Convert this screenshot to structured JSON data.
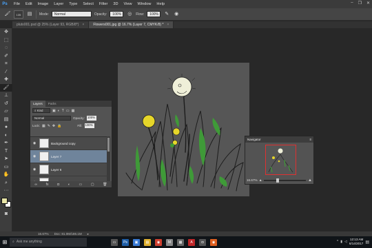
{
  "app": {
    "logo": "Ps"
  },
  "menu": [
    "File",
    "Edit",
    "Image",
    "Layer",
    "Type",
    "Select",
    "Filter",
    "3D",
    "View",
    "Window",
    "Help"
  ],
  "window_controls": [
    "–",
    "❐",
    "✕"
  ],
  "options": {
    "brush_size": "135",
    "mode_label": "Mode:",
    "mode_value": "Normal",
    "opacity_label": "Opacity:",
    "opacity_value": "100%",
    "flow_label": "Flow:",
    "flow_value": "100%"
  },
  "tabs": [
    {
      "label": "pluto001.psd @ 25% (Layer 93, RGB/8*)",
      "close": "×",
      "active": false
    },
    {
      "label": "Flowers001.jpg @ 16.7% (Layer 7, CMYK/8) *",
      "close": "×",
      "active": true
    }
  ],
  "tools": [
    "move-tool",
    "marquee-tool",
    "lasso-tool",
    "quick-select-tool",
    "crop-tool",
    "eyedropper-tool",
    "healing-tool",
    "brush-tool",
    "stamp-tool",
    "history-brush-tool",
    "eraser-tool",
    "gradient-tool",
    "blur-tool",
    "dodge-tool",
    "pen-tool",
    "type-tool",
    "path-select-tool",
    "shape-tool",
    "hand-tool",
    "zoom-tool"
  ],
  "colors": {
    "foreground": "#e9e6a8",
    "background": "#ffffff",
    "accent": "#6f849b"
  },
  "layers_panel": {
    "tabs": [
      "Layers",
      "Paths"
    ],
    "filter_kind": "Kind",
    "blend_mode": "Normal",
    "opacity_label": "Opacity:",
    "opacity_value": "100%",
    "lock_label": "Lock:",
    "fill_label": "Fill:",
    "fill_value": "100%",
    "layers": [
      {
        "name": "Background copy",
        "visible": true,
        "selected": false
      },
      {
        "name": "Layer 7",
        "visible": true,
        "selected": true
      },
      {
        "name": "Layer 6",
        "visible": true,
        "selected": false
      },
      {
        "name": "",
        "visible": true,
        "selected": false
      }
    ],
    "footer_icons": [
      "link-icon",
      "fx-icon",
      "mask-icon",
      "adjustment-icon",
      "group-icon",
      "new-layer-icon",
      "trash-icon"
    ]
  },
  "navigator": {
    "title": "Navigator",
    "zoom": "16.67%"
  },
  "status": {
    "zoom": "16.67%",
    "doc": "Doc: 81.0M/186.1M"
  },
  "taskbar": {
    "search_placeholder": "Ask me anything",
    "apps": [
      {
        "name": "task-view-icon",
        "color": "#555555",
        "glyph": "▭"
      },
      {
        "name": "photoshop-app-icon",
        "color": "#1f5fa8",
        "glyph": "Ps"
      },
      {
        "name": "photos-app-icon",
        "color": "#3a7bd5",
        "glyph": "▣"
      },
      {
        "name": "file-explorer-icon",
        "color": "#e0b030",
        "glyph": "▤"
      },
      {
        "name": "chrome-icon",
        "color": "#d04030",
        "glyph": "◉"
      },
      {
        "name": "app-m-icon",
        "color": "#888888",
        "glyph": "M"
      },
      {
        "name": "notes-app-icon",
        "color": "#666666",
        "glyph": "▦"
      },
      {
        "name": "acrobat-icon",
        "color": "#c0282a",
        "glyph": "A"
      },
      {
        "name": "app-icon",
        "color": "#555555",
        "glyph": "◘"
      },
      {
        "name": "firefox-icon",
        "color": "#e06020",
        "glyph": "◉"
      }
    ],
    "time": "12:13 AM",
    "date": "6/14/2017"
  }
}
